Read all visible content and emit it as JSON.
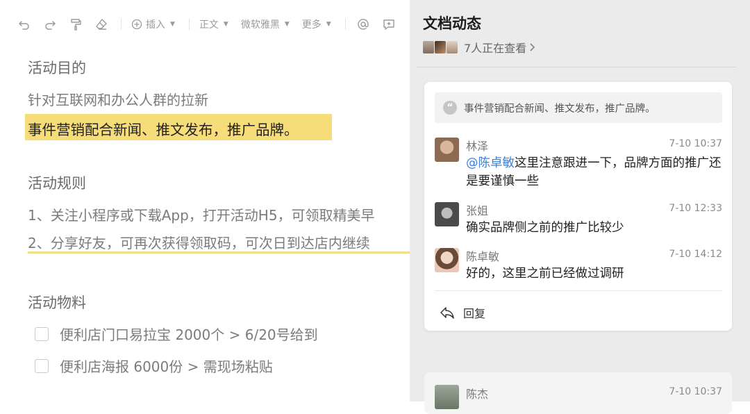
{
  "toolbar": {
    "insert_label": "插入",
    "style_label": "正文",
    "font_label": "微软雅黑",
    "more_label": "更多"
  },
  "doc": {
    "h1": "活动目的",
    "p1": "针对互联网和办公人群的拉新",
    "p2": "事件营销配合新闻、推文发布，推广品牌。",
    "h2": "活动规则",
    "p3": "1、关注小程序或下载App，打开活动H5，可领取精美早",
    "p4": "2、分享好友，可再次获得领取码，可次日到达店内继续",
    "h3": "活动物料",
    "todos": [
      "便利店门口易拉宝 2000个 > 6/20号给到",
      "便利店海报 6000份 > 需现场粘贴"
    ]
  },
  "panel": {
    "title": "文档动态",
    "viewers_text": "7人正在查看",
    "quote": "事件营销配合新闻、推文发布，推广品牌。",
    "comments": [
      {
        "name": "林泽",
        "time": "7-10 10:37",
        "mention": "@陈卓敏",
        "text": "这里注意跟进一下，品牌方面的推广还是要谨慎一些"
      },
      {
        "name": "张姐",
        "time": "7-10 12:33",
        "mention": "",
        "text": "确实品牌侧之前的推广比较少"
      },
      {
        "name": "陈卓敏",
        "time": "7-10 14:12",
        "mention": "",
        "text": "好的，这里之前已经做过调研"
      }
    ],
    "reply_label": "回复",
    "next_comment": {
      "name": "陈杰",
      "time": "7-10 10:37"
    }
  },
  "icons": [
    "undo-icon",
    "redo-icon",
    "format-painter-icon",
    "eraser-icon",
    "plus-circle-icon",
    "at-icon",
    "comment-add-icon",
    "quote-icon",
    "reply-icon",
    "chevron-right-icon"
  ],
  "colors": {
    "highlight": "#f7dc7a",
    "mention": "#3b7fd6",
    "panel_bg": "#ebebeb"
  }
}
